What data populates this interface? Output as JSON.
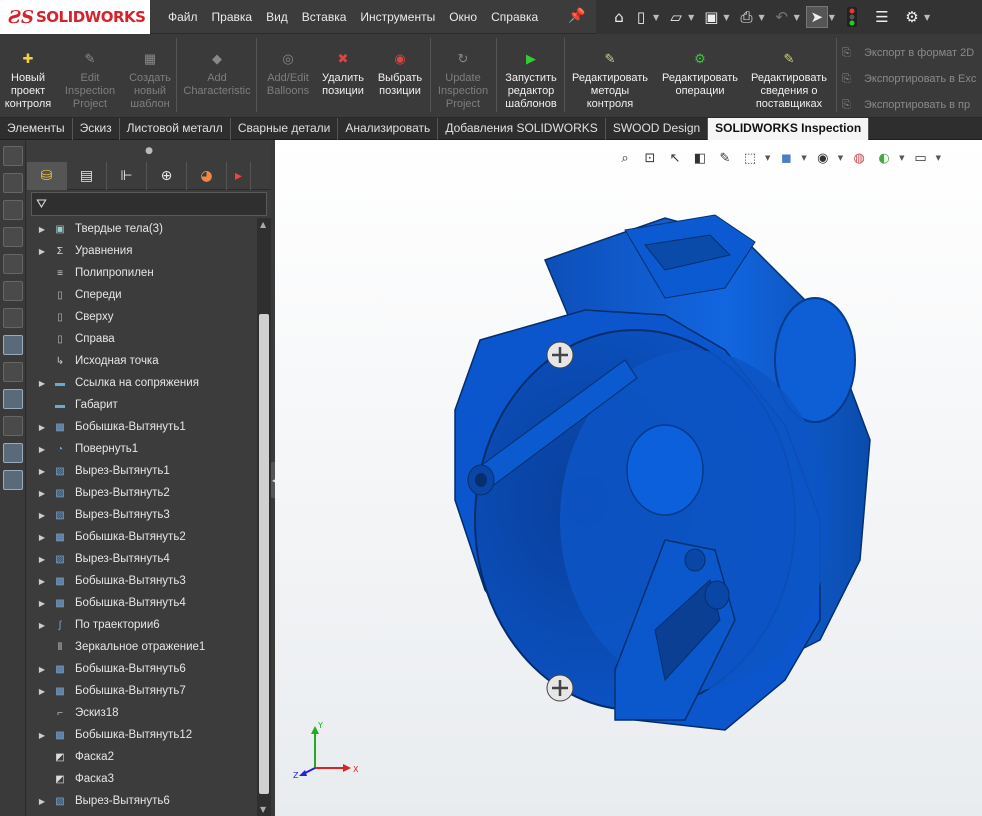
{
  "app": {
    "brand": "SOLIDWORKS"
  },
  "menu": [
    "Файл",
    "Правка",
    "Вид",
    "Вставка",
    "Инструменты",
    "Окно",
    "Справка"
  ],
  "ribbon": {
    "buttons": [
      {
        "label": "Новый проект контроля",
        "enabled": true
      },
      {
        "label": "Edit Inspection Project",
        "enabled": false
      },
      {
        "label": "Создать новый шаблон",
        "enabled": false
      },
      {
        "label": "Add Characteristic",
        "enabled": false
      },
      {
        "label": "Add/Edit Balloons",
        "enabled": false
      },
      {
        "label": "Удалить позиции",
        "enabled": true
      },
      {
        "label": "Выбрать позиции",
        "enabled": true
      },
      {
        "label": "Update Inspection Project",
        "enabled": false
      },
      {
        "label": "Запустить редактор шаблонов",
        "enabled": true
      },
      {
        "label": "Редактировать методы контроля",
        "enabled": true
      },
      {
        "label": "Редактировать операции",
        "enabled": true
      },
      {
        "label": "Редактировать сведения о поставщиках",
        "enabled": true
      }
    ],
    "side_list": [
      "Экспорт в формат 2D",
      "Экспортировать в Exc",
      "Экспортировать в пр"
    ]
  },
  "tabs": [
    {
      "label": "Элементы",
      "active": false
    },
    {
      "label": "Эскиз",
      "active": false
    },
    {
      "label": "Листовой металл",
      "active": false
    },
    {
      "label": "Сварные детали",
      "active": false
    },
    {
      "label": "Анализировать",
      "active": false
    },
    {
      "label": "Добавления SOLIDWORKS",
      "active": false
    },
    {
      "label": "SWOOD Design",
      "active": false
    },
    {
      "label": "SOLIDWORKS Inspection",
      "active": true
    }
  ],
  "tree": [
    {
      "label": "Твердые тела(3)",
      "icon": "solid-bodies-icon",
      "expand": true
    },
    {
      "label": "Уравнения",
      "icon": "equations-icon",
      "expand": true
    },
    {
      "label": "Полипропилен",
      "icon": "material-icon",
      "expand": false
    },
    {
      "label": "Спереди",
      "icon": "plane-icon",
      "expand": false
    },
    {
      "label": "Сверху",
      "icon": "plane-icon",
      "expand": false
    },
    {
      "label": "Справа",
      "icon": "plane-icon",
      "expand": false
    },
    {
      "label": "Исходная точка",
      "icon": "origin-icon",
      "expand": false
    },
    {
      "label": "Ссылка на сопряжения",
      "icon": "folder-icon",
      "expand": true
    },
    {
      "label": "Габарит",
      "icon": "folder-icon",
      "expand": false
    },
    {
      "label": "Бобышка-Вытянуть1",
      "icon": "extrude-icon",
      "expand": true
    },
    {
      "label": "Повернуть1",
      "icon": "revolve-icon",
      "expand": true
    },
    {
      "label": "Вырез-Вытянуть1",
      "icon": "cut-icon",
      "expand": true
    },
    {
      "label": "Вырез-Вытянуть2",
      "icon": "cut-icon",
      "expand": true
    },
    {
      "label": "Вырез-Вытянуть3",
      "icon": "cut-icon",
      "expand": true
    },
    {
      "label": "Бобышка-Вытянуть2",
      "icon": "extrude-icon",
      "expand": true
    },
    {
      "label": "Вырез-Вытянуть4",
      "icon": "cut-icon",
      "expand": true
    },
    {
      "label": "Бобышка-Вытянуть3",
      "icon": "extrude-icon",
      "expand": true
    },
    {
      "label": "Бобышка-Вытянуть4",
      "icon": "extrude-icon",
      "expand": true
    },
    {
      "label": "По траектории6",
      "icon": "sweep-icon",
      "expand": true
    },
    {
      "label": "Зеркальное отражение1",
      "icon": "mirror-icon",
      "expand": false
    },
    {
      "label": "Бобышка-Вытянуть6",
      "icon": "extrude-icon",
      "expand": true
    },
    {
      "label": "Бобышка-Вытянуть7",
      "icon": "extrude-icon",
      "expand": true
    },
    {
      "label": "Эскиз18",
      "icon": "sketch-icon",
      "expand": false
    },
    {
      "label": "Бобышка-Вытянуть12",
      "icon": "extrude-icon",
      "expand": true
    },
    {
      "label": "Фаска2",
      "icon": "chamfer-icon",
      "expand": false
    },
    {
      "label": "Фаска3",
      "icon": "chamfer-icon",
      "expand": false
    },
    {
      "label": "Вырез-Вытянуть6",
      "icon": "cut-icon",
      "expand": true
    }
  ],
  "triad": {
    "x": "X",
    "y": "Y",
    "z": "Z"
  },
  "colors": {
    "model": "#0a5bd0",
    "model_dark": "#063a8c",
    "selection": "#546e86",
    "active_tab": "#f5f5f5"
  }
}
